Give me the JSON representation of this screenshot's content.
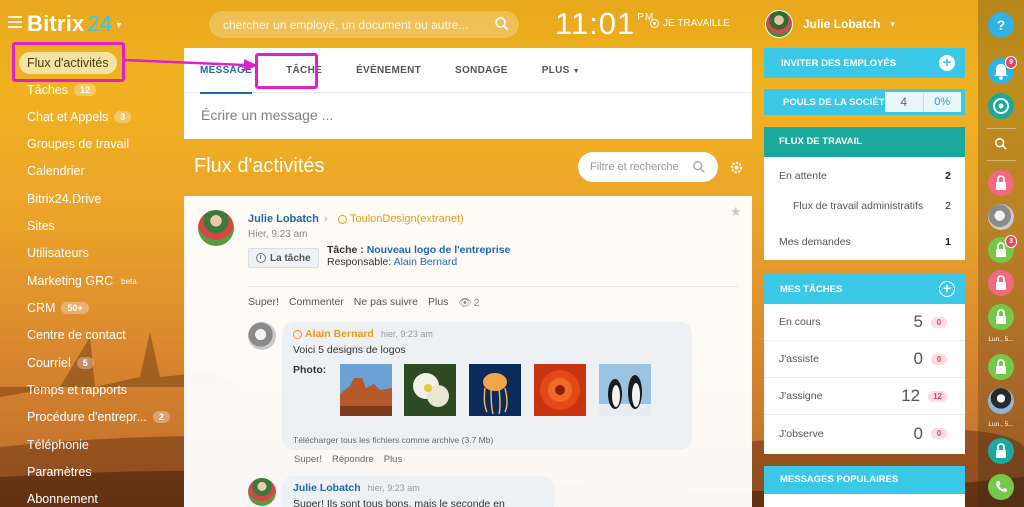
{
  "app": {
    "logo_text": "Bitrix",
    "logo_number": "24"
  },
  "header": {
    "search_placeholder": "chercher un employé, un document ou autre...",
    "clock_time": "11:01",
    "clock_ampm": "PM",
    "work_status": "JE TRAVAILLE",
    "user_name": "Julie Lobatch"
  },
  "sidebar": {
    "items": [
      {
        "label": "Flux d'activités"
      },
      {
        "label": "Tâches",
        "badge": "12"
      },
      {
        "label": "Chat et Appels",
        "badge": "3"
      },
      {
        "label": "Groupes de travail"
      },
      {
        "label": "Calendrier"
      },
      {
        "label": "Bitrix24.Drive"
      },
      {
        "label": "Sites"
      },
      {
        "label": "Utilisateurs"
      },
      {
        "label": "Marketing GRC",
        "sup": "beta"
      },
      {
        "label": "CRM",
        "badge": "50+"
      },
      {
        "label": "Centre de contact"
      },
      {
        "label": "Courriel",
        "badge": "5"
      },
      {
        "label": "Temps et rapports"
      },
      {
        "label": "Procédure d'entrepr...",
        "badge": "2"
      },
      {
        "label": "Téléphonie"
      },
      {
        "label": "Paramètres"
      },
      {
        "label": "Abonnement"
      }
    ]
  },
  "composer": {
    "tabs": [
      "MESSAGE",
      "TÂCHE",
      "ÉVÈNEMENT",
      "SONDAGE",
      "PLUS"
    ],
    "placeholder": "Écrire un message ..."
  },
  "feed": {
    "title": "Flux d'activités",
    "filter_placeholder": "Filtre et recherche"
  },
  "post": {
    "author": "Julie Lobatch",
    "group": "ToulonDesign(extranet)",
    "time": "Hier, 9:23 am",
    "chip": "La tâche",
    "task_label": "Tâche :",
    "task_name": "Nouveau logo de l'entreprise",
    "resp_label": "Responsable:",
    "resp_name": "Alain Bernard",
    "actions": [
      "Super!",
      "Commenter",
      "Ne pas suivre",
      "Plus"
    ],
    "views": "2"
  },
  "comment1": {
    "author": "Alain Bernard",
    "time": "hier, 9:23 am",
    "text": "Voici 5 designs de logos",
    "photo_label": "Photo:",
    "download": "Télécharger tous les fichiers comme archive (3.7 Mb)",
    "actions": [
      "Super!",
      "Répondre",
      "Plus"
    ]
  },
  "comment2": {
    "author": "Julie Lobatch",
    "time": "hier, 9:23 am",
    "text": "Super! Ils sont tous bons, mais le seconde en particulier!"
  },
  "right": {
    "invite": "INVITER DES EMPLOYÉS",
    "pulse_label": "POULS DE LA SOCIÉTÉ",
    "pulse_value": "4",
    "pulse_percent": "0%",
    "workflow_title": "FLUX DE TRAVAIL",
    "workflow": [
      {
        "label": "En attente",
        "value": "2"
      },
      {
        "label": "Flux de travail administratifs",
        "value": "2"
      },
      {
        "label": "Mes demandes",
        "value": "1"
      }
    ],
    "tasks_title": "MES TÂCHES",
    "tasks": [
      {
        "label": "En cours",
        "value": "5",
        "count": "0"
      },
      {
        "label": "J'assiste",
        "value": "0",
        "count": "0"
      },
      {
        "label": "J'assigne",
        "value": "12",
        "count": "12"
      },
      {
        "label": "J'observe",
        "value": "0",
        "count": "0"
      }
    ],
    "popular_title": "MESSAGES POPULAIRES"
  },
  "rail": {
    "help": "?",
    "bell_badge": "9",
    "lock_badge": "3",
    "time1": "Lun., 5...",
    "time2": "Lun., 5..."
  },
  "colors": {
    "accent": "#3bc8e7",
    "link": "#2067b0",
    "workflow": "#1ca99d",
    "highlight": "#e020c8"
  }
}
